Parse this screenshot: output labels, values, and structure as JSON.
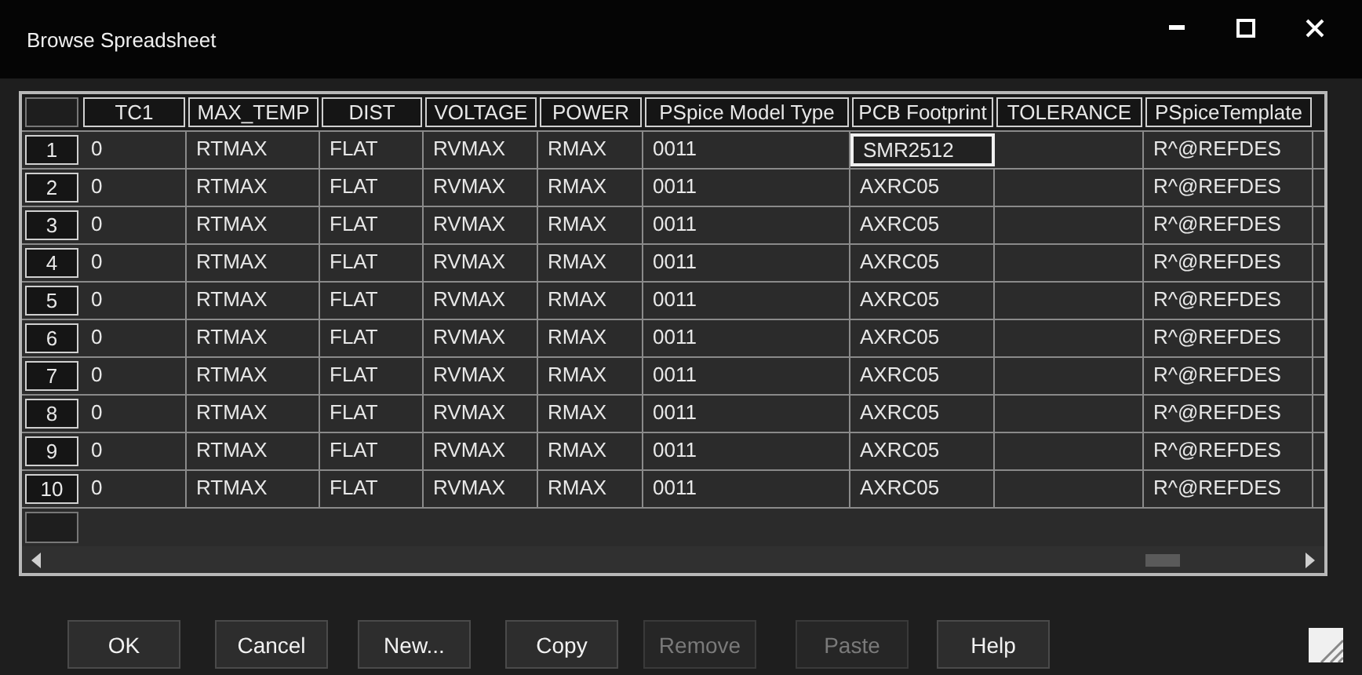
{
  "window": {
    "title": "Browse Spreadsheet"
  },
  "table": {
    "columns": [
      "TC1",
      "MAX_TEMP",
      "DIST",
      "VOLTAGE",
      "POWER",
      "PSpice Model Type",
      "PCB Footprint",
      "TOLERANCE",
      "PSpiceTemplate"
    ],
    "rows": [
      {
        "number": "1",
        "cells": [
          {
            "text": "0",
            "focused": false
          },
          {
            "text": "RTMAX",
            "focused": false
          },
          {
            "text": "FLAT",
            "focused": false
          },
          {
            "text": "RVMAX",
            "focused": false
          },
          {
            "text": "RMAX",
            "focused": false
          },
          {
            "text": "0011",
            "focused": false
          },
          {
            "text": "SMR2512",
            "focused": true
          },
          {
            "focused": false
          },
          {
            "text": "R^@REFDES",
            "focused": false
          }
        ]
      },
      {
        "number": "2",
        "cells": [
          {
            "text": "0",
            "focused": false
          },
          {
            "text": "RTMAX",
            "focused": false
          },
          {
            "text": "FLAT",
            "focused": false
          },
          {
            "text": "RVMAX",
            "focused": false
          },
          {
            "text": "RMAX",
            "focused": false
          },
          {
            "text": "0011",
            "focused": false
          },
          {
            "text": "AXRC05",
            "focused": false
          },
          {
            "focused": false
          },
          {
            "text": "R^@REFDES",
            "focused": false
          }
        ]
      },
      {
        "number": "3",
        "cells": [
          {
            "text": "0",
            "focused": false
          },
          {
            "text": "RTMAX",
            "focused": false
          },
          {
            "text": "FLAT",
            "focused": false
          },
          {
            "text": "RVMAX",
            "focused": false
          },
          {
            "text": "RMAX",
            "focused": false
          },
          {
            "text": "0011",
            "focused": false
          },
          {
            "text": "AXRC05",
            "focused": false
          },
          {
            "focused": false
          },
          {
            "text": "R^@REFDES",
            "focused": false
          }
        ]
      },
      {
        "number": "4",
        "cells": [
          {
            "text": "0",
            "focused": false
          },
          {
            "text": "RTMAX",
            "focused": false
          },
          {
            "text": "FLAT",
            "focused": false
          },
          {
            "text": "RVMAX",
            "focused": false
          },
          {
            "text": "RMAX",
            "focused": false
          },
          {
            "text": "0011",
            "focused": false
          },
          {
            "text": "AXRC05",
            "focused": false
          },
          {
            "focused": false
          },
          {
            "text": "R^@REFDES",
            "focused": false
          }
        ]
      },
      {
        "number": "5",
        "cells": [
          {
            "text": "0",
            "focused": false
          },
          {
            "text": "RTMAX",
            "focused": false
          },
          {
            "text": "FLAT",
            "focused": false
          },
          {
            "text": "RVMAX",
            "focused": false
          },
          {
            "text": "RMAX",
            "focused": false
          },
          {
            "text": "0011",
            "focused": false
          },
          {
            "text": "AXRC05",
            "focused": false
          },
          {
            "focused": false
          },
          {
            "text": "R^@REFDES",
            "focused": false
          }
        ]
      },
      {
        "number": "6",
        "cells": [
          {
            "text": "0",
            "focused": false
          },
          {
            "text": "RTMAX",
            "focused": false
          },
          {
            "text": "FLAT",
            "focused": false
          },
          {
            "text": "RVMAX",
            "focused": false
          },
          {
            "text": "RMAX",
            "focused": false
          },
          {
            "text": "0011",
            "focused": false
          },
          {
            "text": "AXRC05",
            "focused": false
          },
          {
            "focused": false
          },
          {
            "text": "R^@REFDES",
            "focused": false
          }
        ]
      },
      {
        "number": "7",
        "cells": [
          {
            "text": "0",
            "focused": false
          },
          {
            "text": "RTMAX",
            "focused": false
          },
          {
            "text": "FLAT",
            "focused": false
          },
          {
            "text": "RVMAX",
            "focused": false
          },
          {
            "text": "RMAX",
            "focused": false
          },
          {
            "text": "0011",
            "focused": false
          },
          {
            "text": "AXRC05",
            "focused": false
          },
          {
            "focused": false
          },
          {
            "text": "R^@REFDES",
            "focused": false
          }
        ]
      },
      {
        "number": "8",
        "cells": [
          {
            "text": "0",
            "focused": false
          },
          {
            "text": "RTMAX",
            "focused": false
          },
          {
            "text": "FLAT",
            "focused": false
          },
          {
            "text": "RVMAX",
            "focused": false
          },
          {
            "text": "RMAX",
            "focused": false
          },
          {
            "text": "0011",
            "focused": false
          },
          {
            "text": "AXRC05",
            "focused": false
          },
          {
            "focused": false
          },
          {
            "text": "R^@REFDES",
            "focused": false
          }
        ]
      },
      {
        "number": "9",
        "cells": [
          {
            "text": "0",
            "focused": false
          },
          {
            "text": "RTMAX",
            "focused": false
          },
          {
            "text": "FLAT",
            "focused": false
          },
          {
            "text": "RVMAX",
            "focused": false
          },
          {
            "text": "RMAX",
            "focused": false
          },
          {
            "text": "0011",
            "focused": false
          },
          {
            "text": "AXRC05",
            "focused": false
          },
          {
            "focused": false
          },
          {
            "text": "R^@REFDES",
            "focused": false
          }
        ]
      },
      {
        "number": "10",
        "cells": [
          {
            "text": "0",
            "focused": false
          },
          {
            "text": "RTMAX",
            "focused": false
          },
          {
            "text": "FLAT",
            "focused": false
          },
          {
            "text": "RVMAX",
            "focused": false
          },
          {
            "text": "RMAX",
            "focused": false
          },
          {
            "text": "0011",
            "focused": false
          },
          {
            "text": "AXRC05",
            "focused": false
          },
          {
            "focused": false
          },
          {
            "text": "R^@REFDES",
            "focused": false
          }
        ]
      }
    ]
  },
  "buttons": [
    {
      "label": "OK",
      "disabled": false
    },
    {
      "label": "Cancel",
      "disabled": false
    },
    {
      "label": "New...",
      "disabled": false
    },
    {
      "label": "Copy",
      "disabled": false
    },
    {
      "label": "Remove",
      "disabled": true
    },
    {
      "label": "Paste",
      "disabled": true
    },
    {
      "label": "Help",
      "disabled": false
    }
  ]
}
